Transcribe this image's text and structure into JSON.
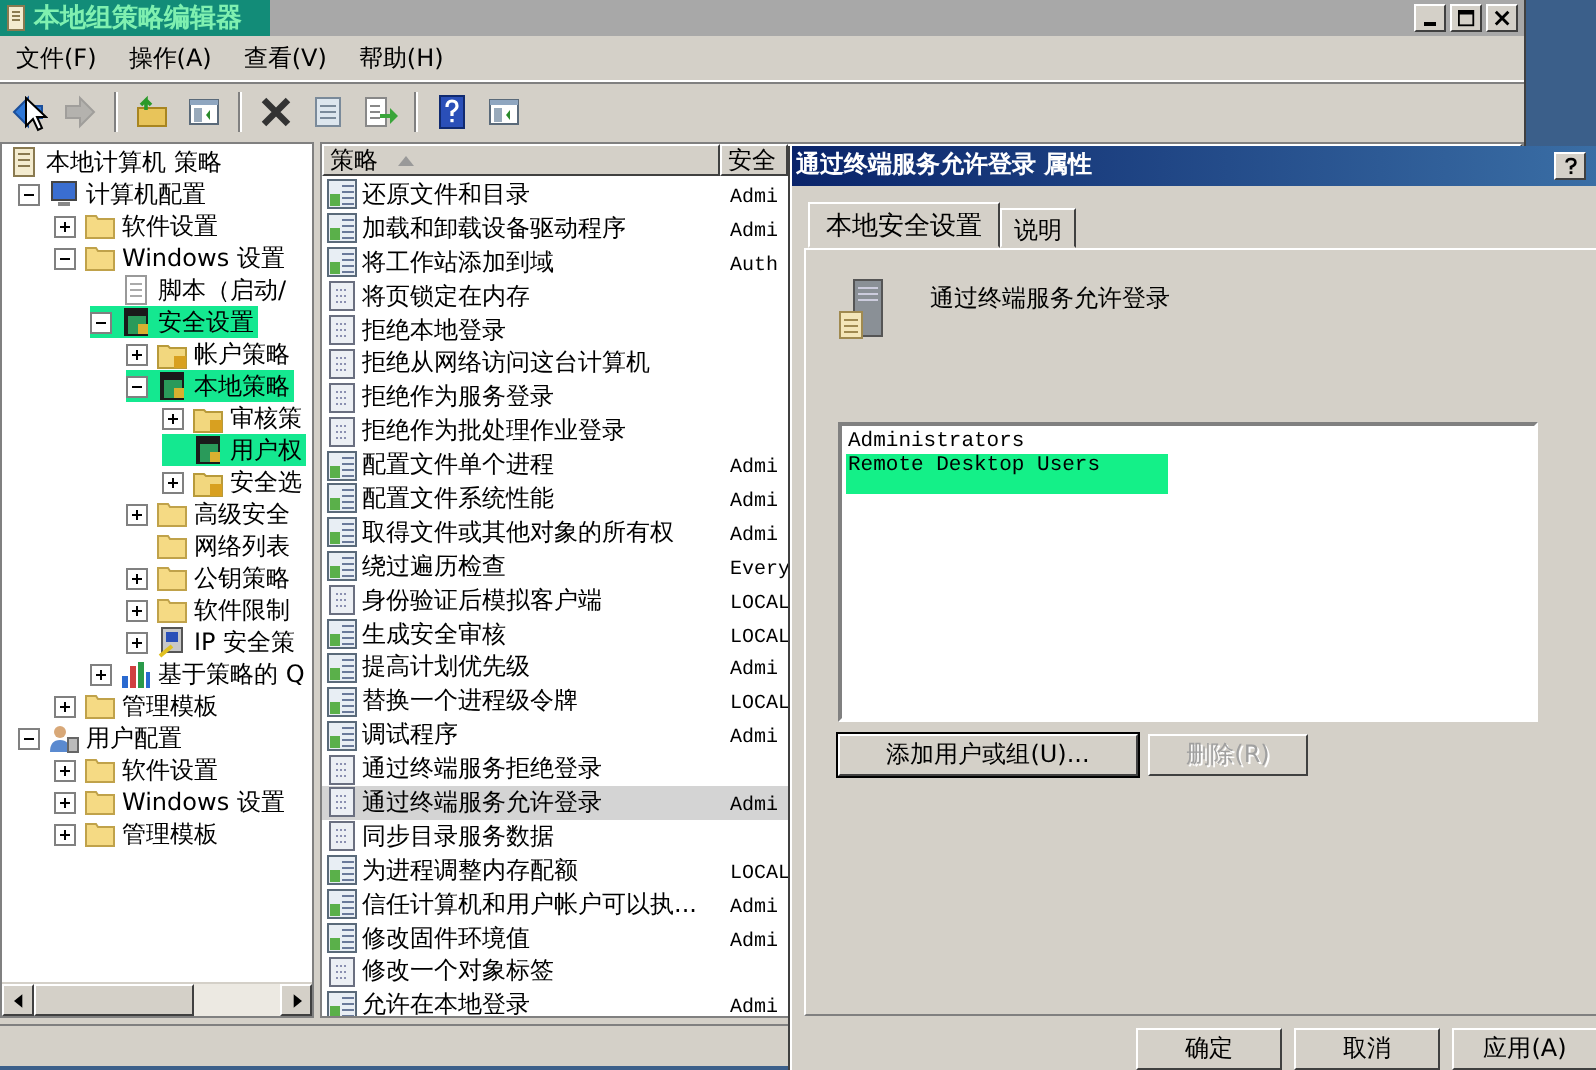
{
  "window": {
    "title": "本地组策略编辑器"
  },
  "menu": [
    "文件(F)",
    "操作(A)",
    "查看(V)",
    "帮助(H)"
  ],
  "toolbar": [
    {
      "kind": "back",
      "disabled": false
    },
    {
      "kind": "forward",
      "disabled": true
    },
    {
      "kind": "separator"
    },
    {
      "kind": "up",
      "disabled": false
    },
    {
      "kind": "tree-toggle",
      "disabled": false
    },
    {
      "kind": "separator"
    },
    {
      "kind": "delete",
      "disabled": false
    },
    {
      "kind": "properties",
      "disabled": false
    },
    {
      "kind": "export",
      "disabled": false
    },
    {
      "kind": "separator"
    },
    {
      "kind": "help",
      "disabled": false
    },
    {
      "kind": "action-toggle",
      "disabled": false
    }
  ],
  "tree": {
    "label": "本地计算机 策略",
    "kind": "policy",
    "highlighted": false,
    "children": [
      {
        "label": "计算机配置",
        "kind": "computer",
        "expanded": true,
        "highlighted": false,
        "children": [
          {
            "label": "软件设置",
            "kind": "folder",
            "expanded": false,
            "highlighted": false
          },
          {
            "label": "Windows 设置",
            "kind": "folder",
            "expanded": true,
            "highlighted": false,
            "children": [
              {
                "label": "脚本（启动/",
                "kind": "script",
                "highlighted": false
              },
              {
                "label": "安全设置",
                "kind": "secure",
                "expanded": true,
                "highlighted": true,
                "children": [
                  {
                    "label": "帐户策略",
                    "kind": "lock-folder",
                    "expanded": false,
                    "highlighted": false
                  },
                  {
                    "label": "本地策略",
                    "kind": "secure",
                    "expanded": true,
                    "highlighted": true,
                    "children": [
                      {
                        "label": "审核策",
                        "kind": "lock-folder",
                        "expanded": false,
                        "highlighted": false
                      },
                      {
                        "label": "用户权",
                        "kind": "secure",
                        "highlighted": true
                      },
                      {
                        "label": "安全选",
                        "kind": "lock-folder",
                        "expanded": false,
                        "highlighted": false
                      }
                    ]
                  },
                  {
                    "label": "高级安全",
                    "kind": "folder",
                    "expanded": false,
                    "highlighted": false
                  },
                  {
                    "label": "网络列表",
                    "kind": "folder",
                    "highlighted": false
                  },
                  {
                    "label": "公钥策略",
                    "kind": "folder",
                    "expanded": false,
                    "highlighted": false
                  },
                  {
                    "label": "软件限制",
                    "kind": "folder",
                    "expanded": false,
                    "highlighted": false
                  },
                  {
                    "label": "IP 安全策",
                    "kind": "ip",
                    "expanded": false,
                    "highlighted": false
                  }
                ]
              },
              {
                "label": "基于策略的 Q",
                "kind": "chart",
                "expanded": false,
                "highlighted": false
              }
            ]
          },
          {
            "label": "管理模板",
            "kind": "folder",
            "expanded": false,
            "highlighted": false
          }
        ]
      },
      {
        "label": "用户配置",
        "kind": "user",
        "expanded": true,
        "highlighted": false,
        "children": [
          {
            "label": "软件设置",
            "kind": "folder",
            "expanded": false,
            "highlighted": false
          },
          {
            "label": "Windows 设置",
            "kind": "folder",
            "expanded": false,
            "highlighted": false
          },
          {
            "label": "管理模板",
            "kind": "folder",
            "expanded": false,
            "highlighted": false
          }
        ]
      }
    ]
  },
  "list": {
    "columns": [
      {
        "label": "策略",
        "sorted": true
      },
      {
        "label": "安全",
        "sorted": false
      }
    ],
    "rows": [
      {
        "name": "还原文件和目录",
        "kind": "defined",
        "column_2": "Admi",
        "selected": false
      },
      {
        "name": "加载和卸载设备驱动程序",
        "kind": "defined",
        "column_2": "Admi",
        "selected": false
      },
      {
        "name": "将工作站添加到域",
        "kind": "defined",
        "column_2": "Auth",
        "selected": false
      },
      {
        "name": "将页锁定在内存",
        "kind": "undefined",
        "selected": false
      },
      {
        "name": "拒绝本地登录",
        "kind": "undefined",
        "selected": false
      },
      {
        "name": "拒绝从网络访问这台计算机",
        "kind": "undefined",
        "selected": false
      },
      {
        "name": "拒绝作为服务登录",
        "kind": "undefined",
        "selected": false
      },
      {
        "name": "拒绝作为批处理作业登录",
        "kind": "undefined",
        "selected": false
      },
      {
        "name": "配置文件单个进程",
        "kind": "defined",
        "column_2": "Admi",
        "selected": false
      },
      {
        "name": "配置文件系统性能",
        "kind": "defined",
        "column_2": "Admi",
        "selected": false
      },
      {
        "name": "取得文件或其他对象的所有权",
        "kind": "defined",
        "column_2": "Admi",
        "selected": false
      },
      {
        "name": "绕过遍历检查",
        "kind": "defined",
        "column_2": "Every",
        "selected": false
      },
      {
        "name": "身份验证后模拟客户端",
        "kind": "undefined",
        "column_2": "LOCAL",
        "selected": false
      },
      {
        "name": "生成安全审核",
        "kind": "defined",
        "column_2": "LOCAL",
        "selected": false
      },
      {
        "name": "提高计划优先级",
        "kind": "defined",
        "column_2": "Admi",
        "selected": false
      },
      {
        "name": "替换一个进程级令牌",
        "kind": "defined",
        "column_2": "LOCAL",
        "selected": false
      },
      {
        "name": "调试程序",
        "kind": "defined",
        "column_2": "Admi",
        "selected": false
      },
      {
        "name": "通过终端服务拒绝登录",
        "kind": "undefined",
        "selected": false
      },
      {
        "name": "通过终端服务允许登录",
        "kind": "undefined",
        "column_2": "Admi",
        "selected": true
      },
      {
        "name": "同步目录服务数据",
        "kind": "undefined",
        "selected": false
      },
      {
        "name": "为进程调整内存配额",
        "kind": "defined",
        "column_2": "LOCAL",
        "selected": false
      },
      {
        "name": "信任计算机和用户帐户可以执...",
        "kind": "defined",
        "column_2": "Admi",
        "selected": false
      },
      {
        "name": "修改固件环境值",
        "kind": "defined",
        "column_2": "Admi",
        "selected": false
      },
      {
        "name": "修改一个对象标签",
        "kind": "undefined",
        "selected": false
      },
      {
        "name": "允许在本地登录",
        "kind": "defined",
        "column_2": "Admi",
        "selected": false
      }
    ]
  },
  "dialog": {
    "title": "通过终端服务允许登录 属性",
    "tabs": [
      {
        "label": "本地安全设置",
        "selected": true
      },
      {
        "label": "说明",
        "selected": false
      }
    ],
    "heading": "通过终端服务允许登录",
    "members": [
      {
        "name": "Administrators",
        "highlighted": false
      },
      {
        "name": "Remote Desktop Users",
        "highlighted": true
      }
    ],
    "actions": [
      {
        "label": "添加用户或组(U)...",
        "disabled": false
      },
      {
        "label": "删除(R)",
        "disabled": true
      }
    ],
    "buttons": [
      "确定",
      "取消",
      "应用(A)"
    ]
  }
}
